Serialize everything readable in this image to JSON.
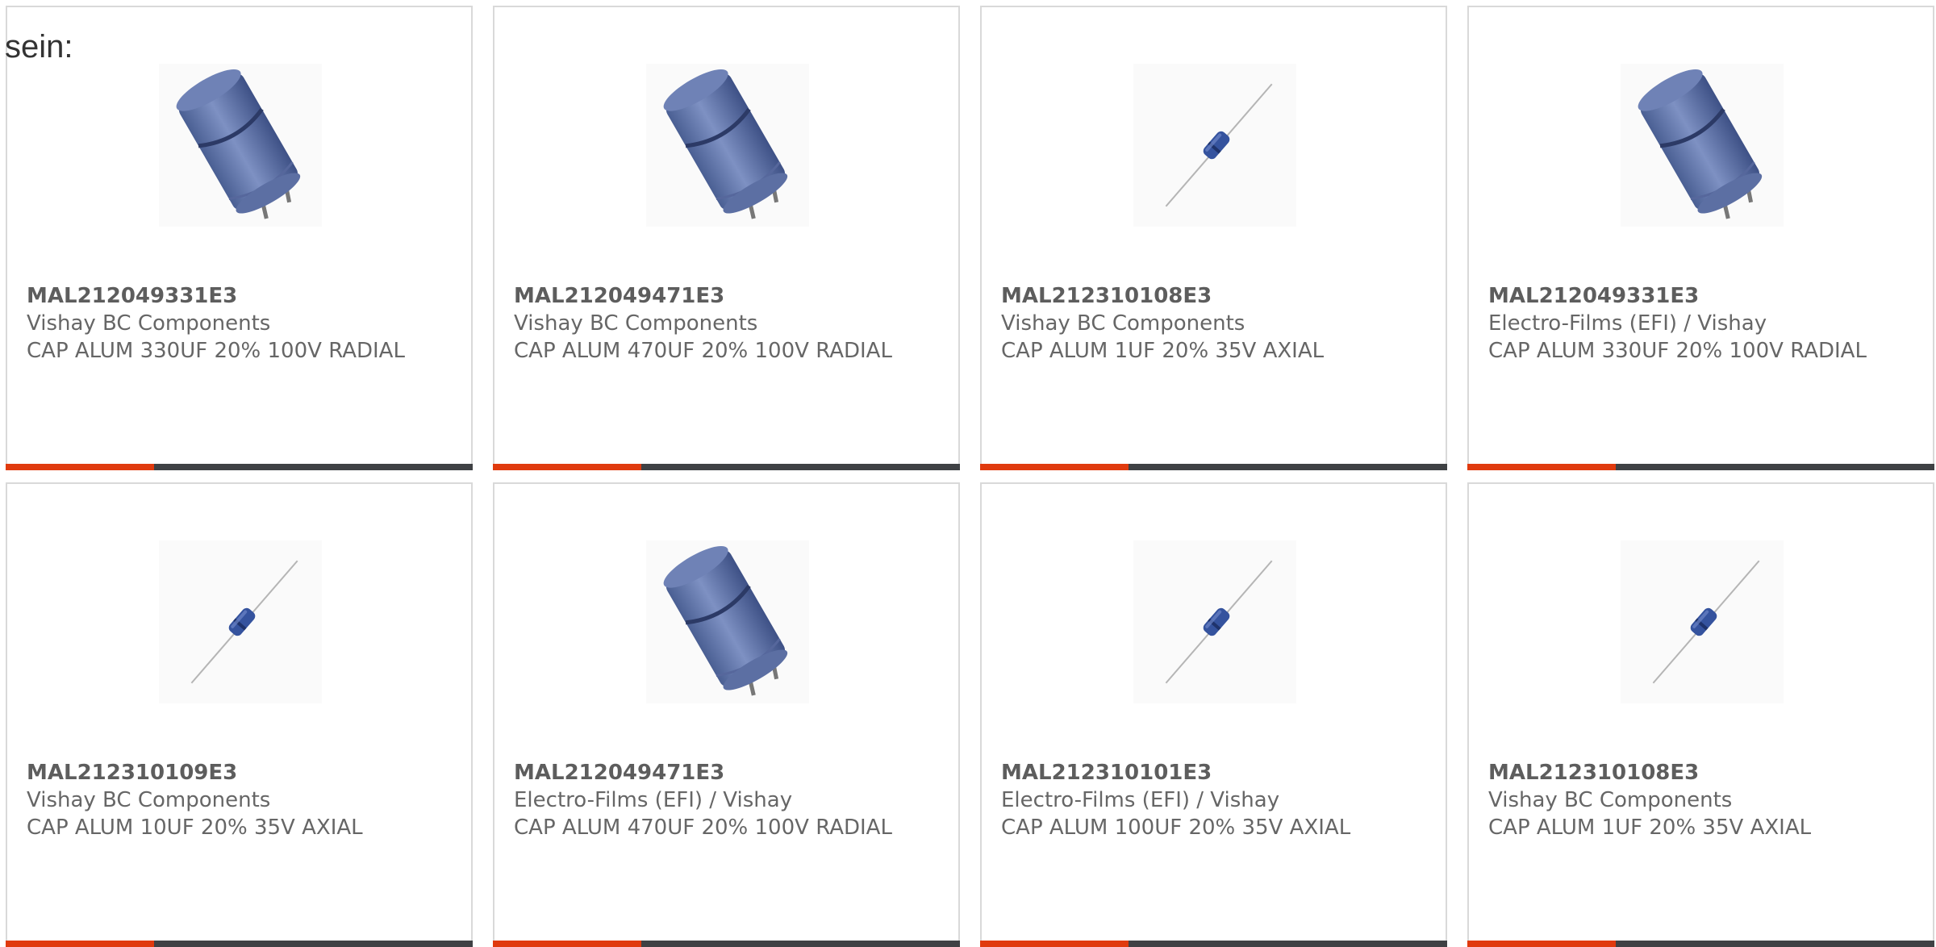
{
  "intro_text": "sein:",
  "colors": {
    "accent": "#e03a0e",
    "bar_dark": "#3f4144",
    "text": "#666666"
  },
  "products": [
    {
      "part": "MAL212049331E3",
      "manufacturer": "Vishay BC Components",
      "description": "CAP ALUM 330UF 20% 100V RADIAL",
      "image": "radial-capacitor-icon"
    },
    {
      "part": "MAL212049471E3",
      "manufacturer": "Vishay BC Components",
      "description": "CAP ALUM 470UF 20% 100V RADIAL",
      "image": "radial-capacitor-icon"
    },
    {
      "part": "MAL212310108E3",
      "manufacturer": "Vishay BC Components",
      "description": "CAP ALUM 1UF 20% 35V AXIAL",
      "image": "axial-capacitor-icon"
    },
    {
      "part": "MAL212049331E3",
      "manufacturer": "Electro-Films (EFI) / Vishay",
      "description": "CAP ALUM 330UF 20% 100V RADIAL",
      "image": "radial-capacitor-icon"
    },
    {
      "part": "MAL212310109E3",
      "manufacturer": "Vishay BC Components",
      "description": "CAP ALUM 10UF 20% 35V AXIAL",
      "image": "axial-capacitor-icon"
    },
    {
      "part": "MAL212049471E3",
      "manufacturer": "Electro-Films (EFI) / Vishay",
      "description": "CAP ALUM 470UF 20% 100V RADIAL",
      "image": "radial-capacitor-icon"
    },
    {
      "part": "MAL212310101E3",
      "manufacturer": "Electro-Films (EFI) / Vishay",
      "description": "CAP ALUM 100UF 20% 35V AXIAL",
      "image": "axial-capacitor-icon"
    },
    {
      "part": "MAL212310108E3",
      "manufacturer": "Vishay BC Components",
      "description": "CAP ALUM 1UF 20% 35V AXIAL",
      "image": "axial-capacitor-icon"
    }
  ]
}
